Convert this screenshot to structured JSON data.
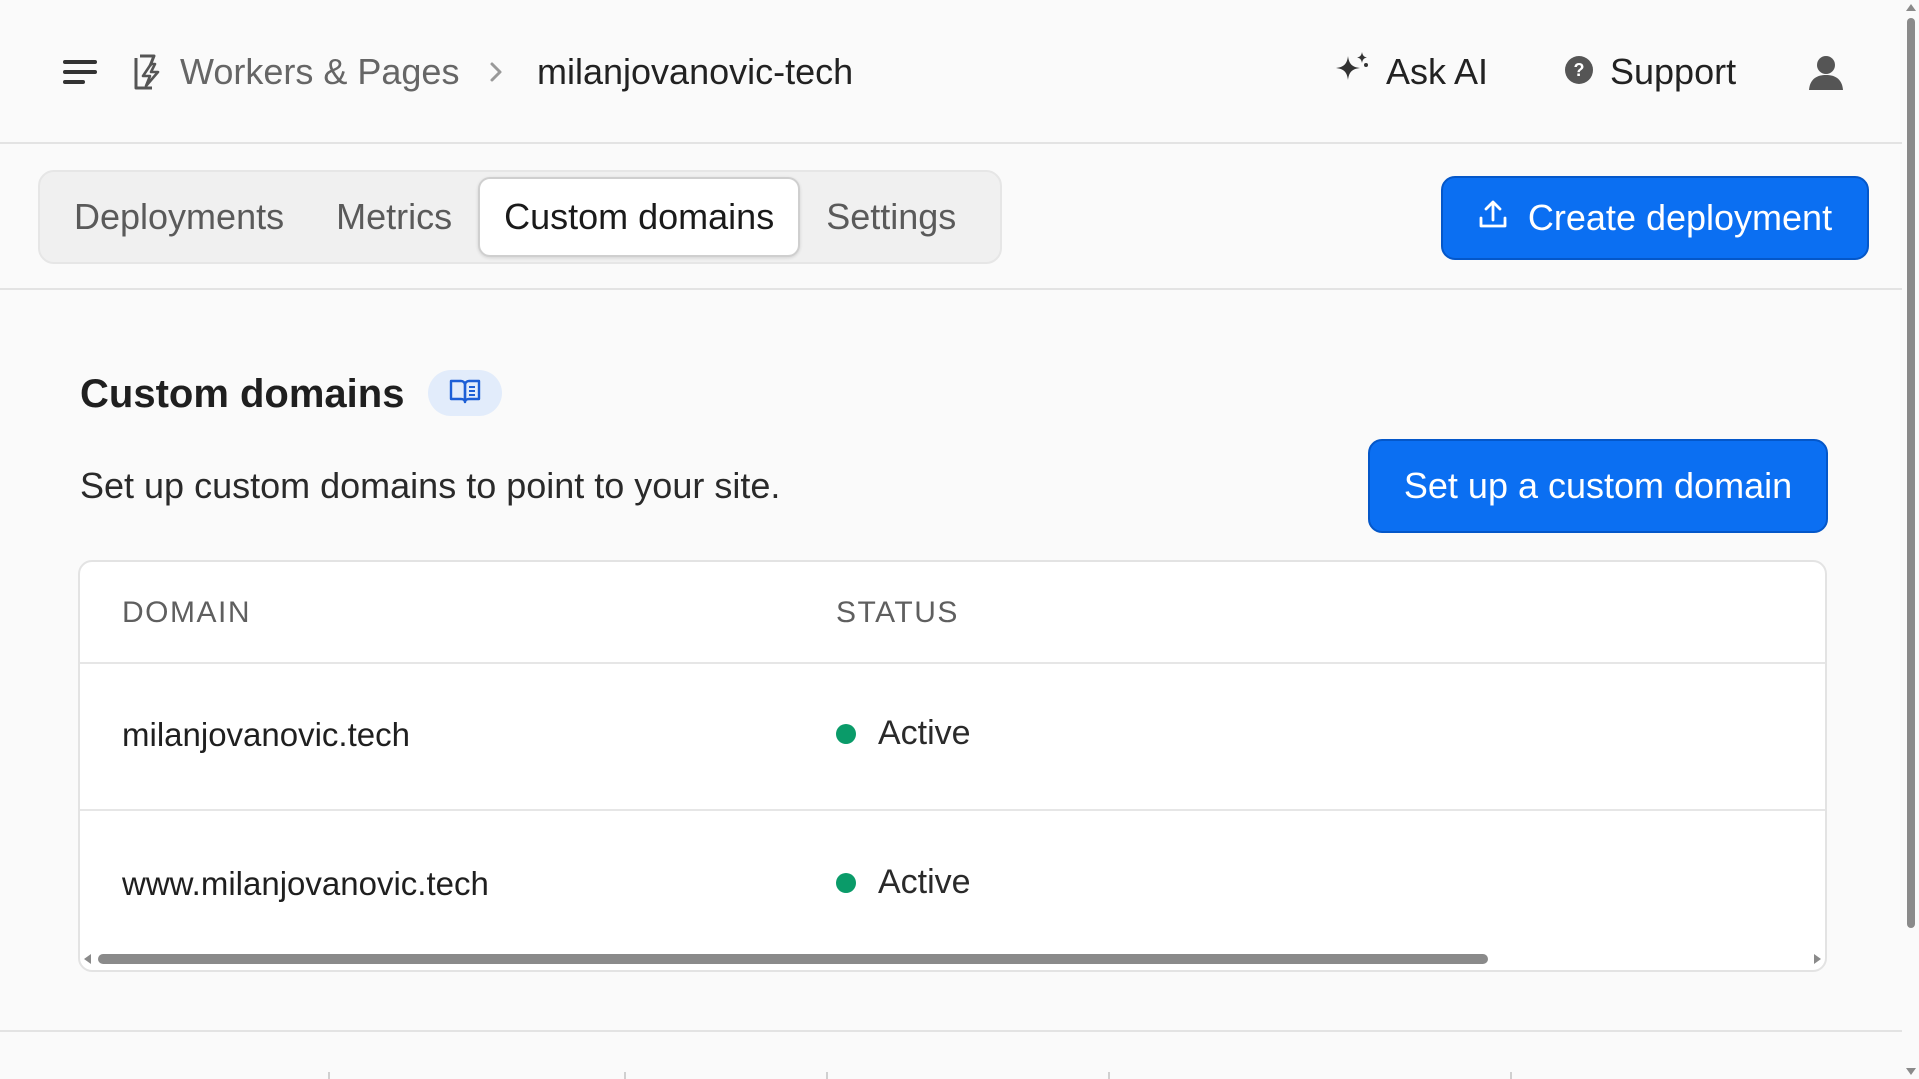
{
  "header": {
    "breadcrumb_parent": "Workers & Pages",
    "breadcrumb_current": "milanjovanovic-tech",
    "ask_ai_label": "Ask AI",
    "support_label": "Support"
  },
  "tabs": [
    {
      "label": "Deployments",
      "active": false
    },
    {
      "label": "Metrics",
      "active": false
    },
    {
      "label": "Custom domains",
      "active": true
    },
    {
      "label": "Settings",
      "active": false
    }
  ],
  "create_deployment_label": "Create deployment",
  "section": {
    "title": "Custom domains",
    "description": "Set up custom domains to point to your site.",
    "setup_button_label": "Set up a custom domain"
  },
  "table": {
    "columns": [
      "DOMAIN",
      "STATUS"
    ],
    "rows": [
      {
        "domain": "milanjovanovic.tech",
        "status": "Active"
      },
      {
        "domain": "www.milanjovanovic.tech",
        "status": "Active"
      }
    ]
  },
  "colors": {
    "primary": "#0b6ff2",
    "status_active": "#0a9b69",
    "badge_bg": "#e2ecfb"
  },
  "icons": {
    "menu": "hamburger-menu-icon",
    "breadcrumb": "workers-bolt-icon",
    "separator": "chevron-right-icon",
    "ask_ai": "sparkle-icon",
    "support": "help-circle-icon",
    "user": "user-icon",
    "upload": "upload-icon",
    "docs": "book-icon"
  }
}
